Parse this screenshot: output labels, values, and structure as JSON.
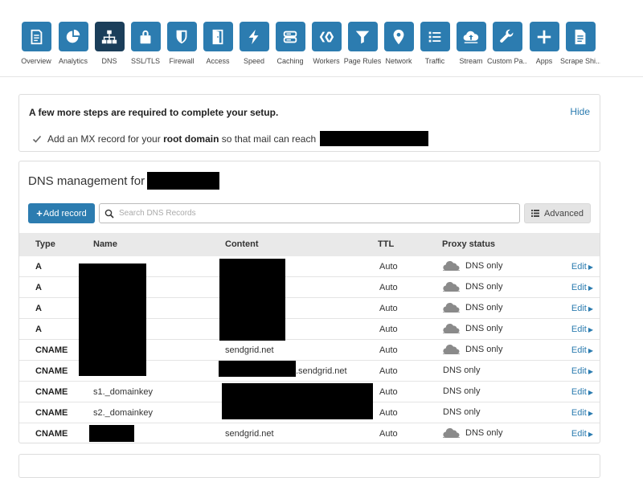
{
  "nav": [
    {
      "label": "Overview",
      "icon": "document-icon"
    },
    {
      "label": "Analytics",
      "icon": "pie-chart-icon"
    },
    {
      "label": "DNS",
      "icon": "network-tree-icon",
      "active": true
    },
    {
      "label": "SSL/TLS",
      "icon": "lock-icon"
    },
    {
      "label": "Firewall",
      "icon": "shield-icon"
    },
    {
      "label": "Access",
      "icon": "door-icon"
    },
    {
      "label": "Speed",
      "icon": "lightning-icon"
    },
    {
      "label": "Caching",
      "icon": "server-icon"
    },
    {
      "label": "Workers",
      "icon": "workers-icon"
    },
    {
      "label": "Page Rules",
      "icon": "filter-icon"
    },
    {
      "label": "Network",
      "icon": "location-pin-icon"
    },
    {
      "label": "Traffic",
      "icon": "list-icon"
    },
    {
      "label": "Stream",
      "icon": "cloud-upload-icon"
    },
    {
      "label": "Custom Pa...",
      "icon": "wrench-icon"
    },
    {
      "label": "Apps",
      "icon": "plus-icon"
    },
    {
      "label": "Scrape Shi...",
      "icon": "document-text-icon"
    }
  ],
  "setup": {
    "title": "A few more steps are required to complete your setup.",
    "hide_label": "Hide",
    "step_prefix": "Add an MX record for your",
    "step_bold": "root domain",
    "step_suffix": "so that mail can reach"
  },
  "dns": {
    "title": "DNS management for",
    "add_label": "Add record",
    "search_placeholder": "Search DNS Records",
    "advanced_label": "Advanced",
    "columns": {
      "type": "Type",
      "name": "Name",
      "content": "Content",
      "ttl": "TTL",
      "proxy": "Proxy status"
    },
    "rows": [
      {
        "type": "A",
        "name": "",
        "content": "",
        "ttl": "Auto",
        "proxy": "DNS only",
        "cloud": true,
        "edit": "Edit"
      },
      {
        "type": "A",
        "name": "",
        "content": "",
        "ttl": "Auto",
        "proxy": "DNS only",
        "cloud": true,
        "edit": "Edit"
      },
      {
        "type": "A",
        "name": "",
        "content": "",
        "ttl": "Auto",
        "proxy": "DNS only",
        "cloud": true,
        "edit": "Edit"
      },
      {
        "type": "A",
        "name": "",
        "content": "",
        "ttl": "Auto",
        "proxy": "DNS only",
        "cloud": true,
        "edit": "Edit"
      },
      {
        "type": "CNAME",
        "name": "",
        "content": "sendgrid.net",
        "ttl": "Auto",
        "proxy": "DNS only",
        "cloud": true,
        "edit": "Edit"
      },
      {
        "type": "CNAME",
        "name": "",
        "content": ".sendgrid.net",
        "ttl": "Auto",
        "proxy": "DNS only",
        "cloud": false,
        "edit": "Edit"
      },
      {
        "type": "CNAME",
        "name": "s1._domainkey",
        "content": "",
        "ttl": "Auto",
        "proxy": "DNS only",
        "cloud": false,
        "edit": "Edit"
      },
      {
        "type": "CNAME",
        "name": "s2._domainkey",
        "content": "",
        "ttl": "Auto",
        "proxy": "DNS only",
        "cloud": false,
        "edit": "Edit"
      },
      {
        "type": "CNAME",
        "name": "",
        "content": "sendgrid.net",
        "ttl": "Auto",
        "proxy": "DNS only",
        "cloud": true,
        "edit": "Edit"
      }
    ]
  },
  "colors": {
    "accent": "#2c7cb0",
    "active_tile": "#1b3e5a",
    "table_header": "#e9e9e9"
  }
}
